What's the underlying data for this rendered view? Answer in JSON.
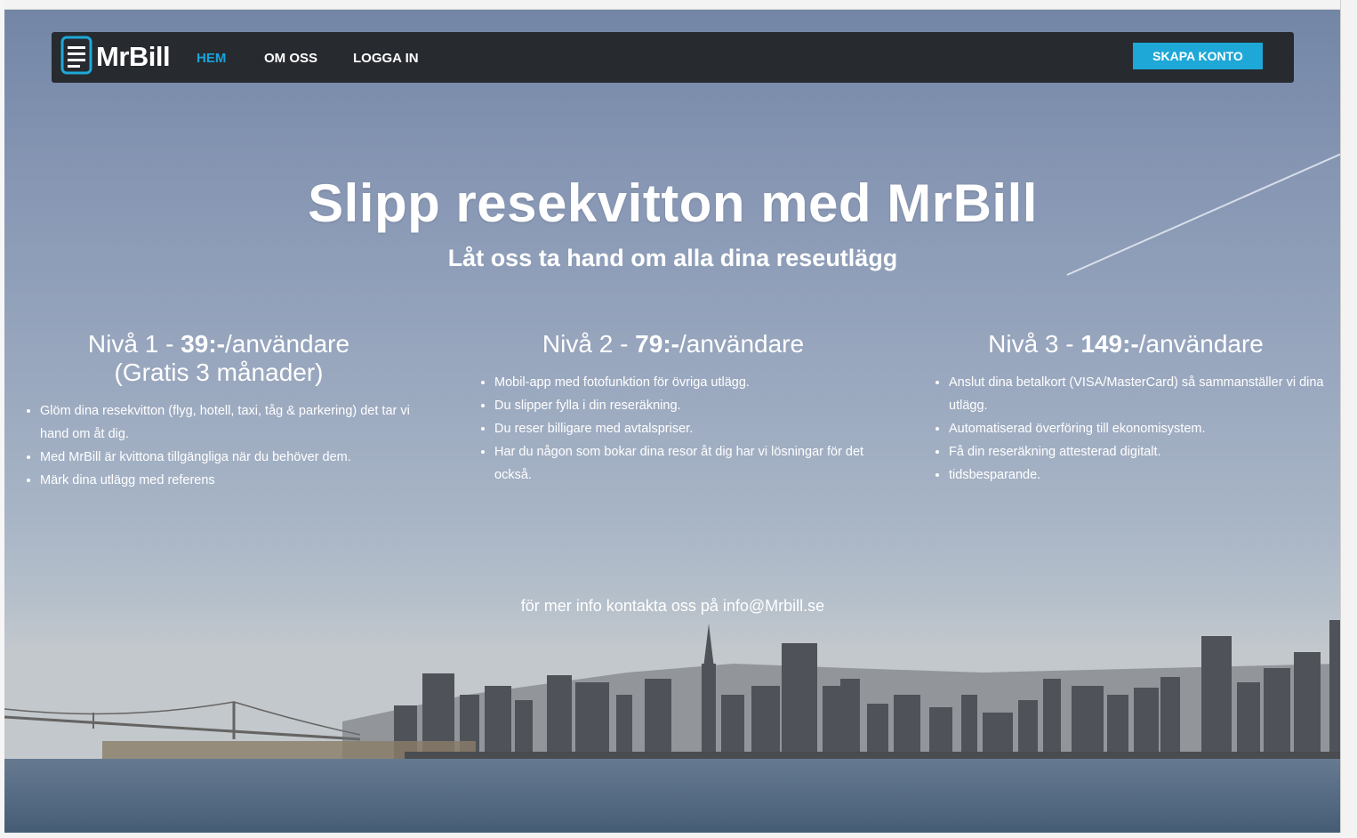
{
  "nav": {
    "logo_text": "MrBill",
    "links": [
      {
        "label": "HEM",
        "active": true
      },
      {
        "label": "OM OSS",
        "active": false
      },
      {
        "label": "LOGGA IN",
        "active": false
      }
    ],
    "cta_label": "SKAPA KONTO"
  },
  "hero": {
    "title": "Slipp resekvitton med MrBill",
    "subtitle": "Låt oss ta hand om alla dina reseutlägg"
  },
  "tiers": [
    {
      "prefix": "Nivå 1 - ",
      "price": "39:-",
      "suffix": "/användare",
      "note": "(Gratis 3 månader)",
      "features": [
        "Glöm dina resekvitton (flyg, hotell, taxi, tåg & parkering) det tar vi hand om åt dig.",
        "Med MrBill är kvittona tillgängliga när du behöver dem.",
        "Märk dina utlägg med referens"
      ]
    },
    {
      "prefix": "Nivå 2 - ",
      "price": "79:-",
      "suffix": "/användare",
      "features": [
        "Mobil-app med fotofunktion för övriga utlägg.",
        "Du slipper fylla i din reseräkning.",
        "Du reser billigare med avtalspriser.",
        "Har du någon som bokar dina resor åt dig har vi lösningar för det också."
      ]
    },
    {
      "prefix": "Nivå 3 - ",
      "price": "149:-",
      "suffix": "/användare",
      "features": [
        "Anslut dina betalkort (VISA/MasterCard) så sammanställer vi dina utlägg.",
        "Automatiserad överföring till ekonomisystem.",
        "Få din reseräkning attesterad digitalt.",
        "tidsbesparande."
      ]
    }
  ],
  "contact": "för mer info kontakta oss på info@Mrbill.se",
  "colors": {
    "navbar": "#272a2f",
    "accent": "#1ea8d8",
    "active_link": "#1aa3da"
  },
  "icons": {
    "logo": "document-list-icon"
  }
}
